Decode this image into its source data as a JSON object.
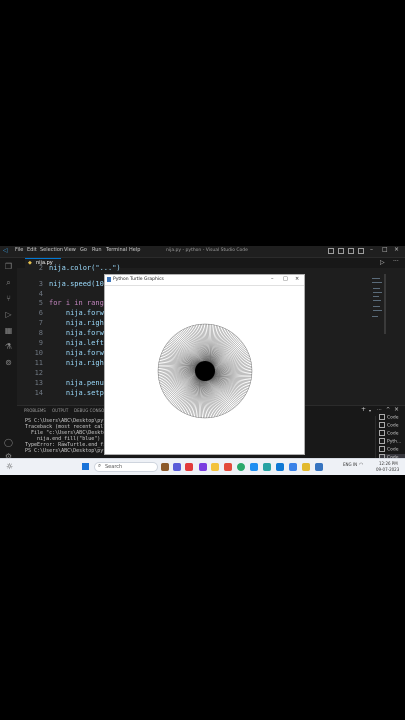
{
  "titlebar": {
    "menu": [
      "File",
      "Edit",
      "Selection",
      "View",
      "Go",
      "Run",
      "Terminal",
      "Help"
    ],
    "window_title": "nija.py - python - Visual Studio Code",
    "controls": [
      "–",
      "□",
      "×"
    ],
    "run_icon": "run-icon",
    "more_label": "···"
  },
  "editor": {
    "tab_label": "nija.py",
    "lines": [
      {
        "n": "2",
        "code": "nija.color(\"...\")"
      },
      {
        "n": "3",
        "code": "nija.speed(10)"
      },
      {
        "n": "4",
        "code": ""
      },
      {
        "n": "5",
        "code": "for i in range("
      },
      {
        "n": "6",
        "code": "    nija.forward("
      },
      {
        "n": "7",
        "code": "    nija.right("
      },
      {
        "n": "8",
        "code": "    nija.forward("
      },
      {
        "n": "9",
        "code": "    nija.left("
      },
      {
        "n": "10",
        "code": "    nija.forward("
      },
      {
        "n": "11",
        "code": "    nija.right("
      },
      {
        "n": "12",
        "code": ""
      },
      {
        "n": "13",
        "code": "    nija.penup("
      },
      {
        "n": "14",
        "code": "    nija.setpos("
      }
    ]
  },
  "panel": {
    "tabs": [
      "PROBLEMS",
      "OUTPUT",
      "DEBUG CONSOLE"
    ],
    "terminal_lines": [
      "PS C:\\Users\\ABC\\Desktop\\pytho",
      "Traceback (most recent call l",
      "  File \"c:\\Users\\ABC\\Desktop\\",
      "    nija.end_fill(\"blue\")",
      "TypeError: RawTurtle.end_fill",
      "PS C:\\Users\\ABC\\Desktop\\pytho"
    ],
    "terminal_list": [
      "Code",
      "Code",
      "Code",
      "Pyth...",
      "Code",
      "Code"
    ]
  },
  "turtle_window": {
    "title": "Python Turtle Graphics",
    "controls": [
      "–",
      "□",
      "×"
    ]
  },
  "taskbar": {
    "search_placeholder": "Search",
    "lang": "ENG IN",
    "time": "12:26 PM",
    "date": "09-07-2023"
  },
  "colors": {
    "accent": "#007acc",
    "editor_bg": "#1e1e1e",
    "keyword": "#c586c0",
    "function": "#dcdcaa"
  }
}
